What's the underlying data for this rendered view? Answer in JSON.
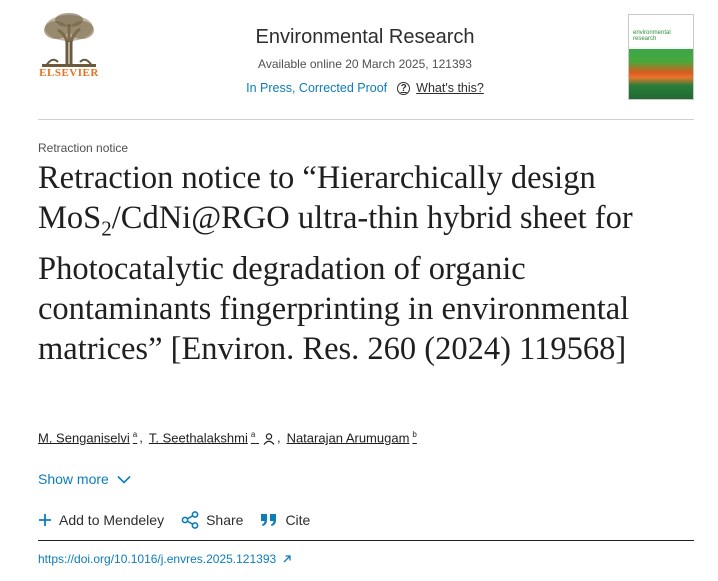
{
  "publisher": {
    "logo_label": "ELSEVIER"
  },
  "journal": {
    "title": "Environmental Research",
    "available": "Available online 20 March 2025, 121393",
    "status_link": "In Press, Corrected Proof",
    "whats_this": "What's this?",
    "cover_title": "environmental research"
  },
  "article": {
    "type": "Retraction notice",
    "title_part1": "Retraction notice to “Hierarchically design MoS",
    "title_sub": "2",
    "title_part2": "/CdNi@RGO ultra-thin hybrid sheet for Photocatalytic degradation of organic contaminants fingerprinting in environmental matrices” [Environ. Res. 260 (2024) 119568]",
    "authors": [
      {
        "name": "M. Senganiselvi",
        "aff": "a"
      },
      {
        "name": "T. Seethalakshmi",
        "aff": "a"
      },
      {
        "name": "Natarajan Arumugam",
        "aff": "b"
      }
    ],
    "show_more": "Show more",
    "doi": "https://doi.org/10.1016/j.envres.2025.121393"
  },
  "actions": {
    "add_mendeley": "Add to Mendeley",
    "share": "Share",
    "cite": "Cite"
  },
  "colors": {
    "link": "#0c7dbb",
    "elsevier_orange": "#e9711c"
  }
}
